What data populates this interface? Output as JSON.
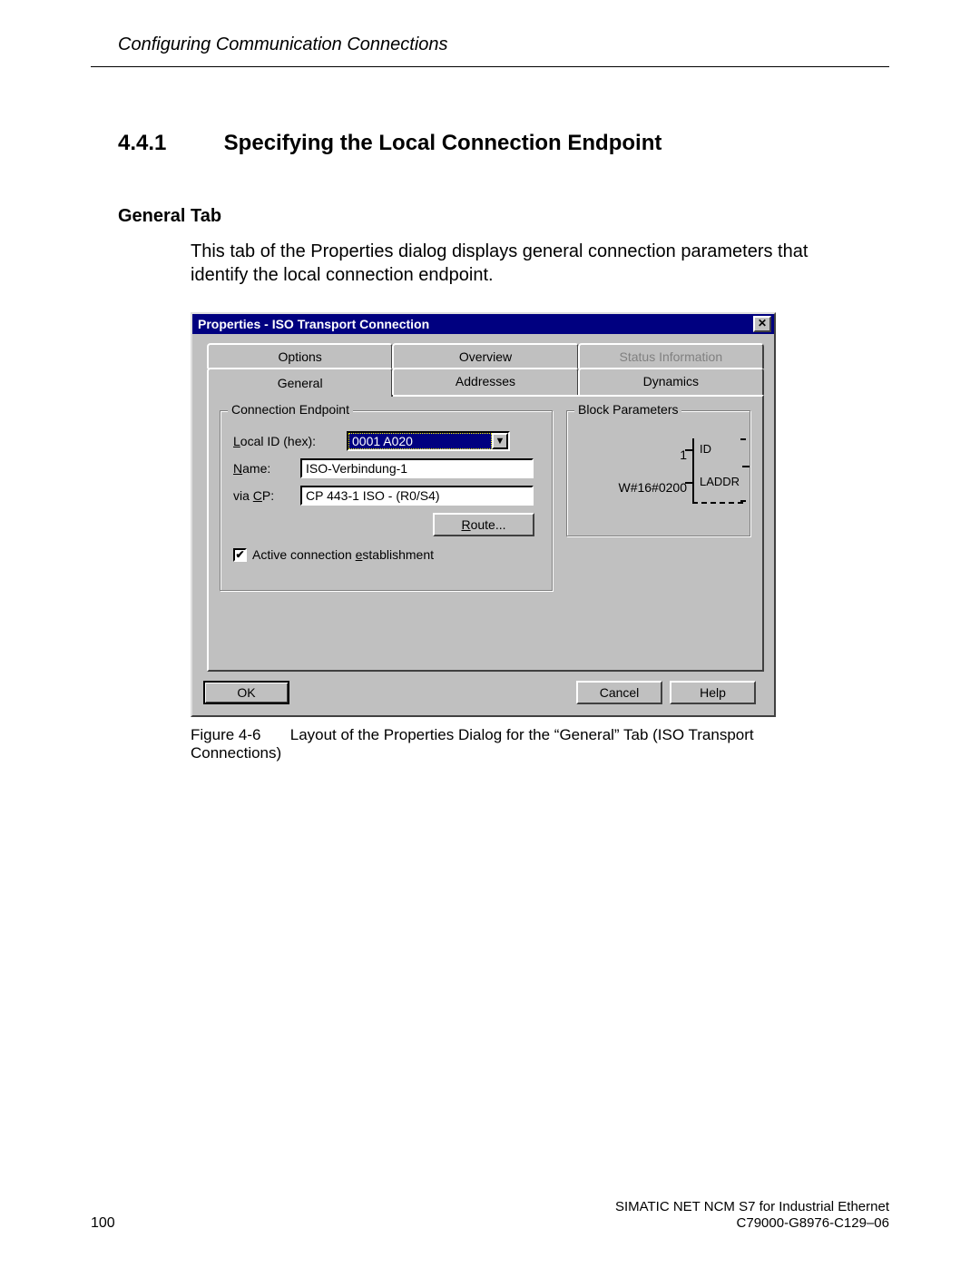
{
  "doc": {
    "running_head": "Configuring Communication Connections",
    "section_no": "4.4.1",
    "section_title": "Specifying the Local Connection Endpoint",
    "subheading": "General Tab",
    "body": "This tab of the Properties dialog displays general connection parameters that identify the local connection endpoint.",
    "figure_no": "Figure 4-6",
    "figure_caption": "Layout of the Properties Dialog for the “General” Tab (ISO Transport Connections)",
    "page_number": "100",
    "footer1": "SIMATIC NET NCM S7 for Industrial Ethernet",
    "footer2": "C79000-G8976-C129–06"
  },
  "dialog": {
    "title": "Properties - ISO Transport Connection",
    "tabs_back": [
      {
        "label": "Options",
        "disabled": false
      },
      {
        "label": "Overview",
        "disabled": false
      },
      {
        "label": "Status Information",
        "disabled": true
      }
    ],
    "tabs_front": [
      {
        "label": "General",
        "active": true
      },
      {
        "label": "Addresses"
      },
      {
        "label": "Dynamics"
      }
    ],
    "conn_group": {
      "legend": "Connection Endpoint",
      "local_id_label_pre": "L",
      "local_id_label_post": "ocal ID (hex):",
      "local_id_value": "0001 A020",
      "name_label_pre": "N",
      "name_label_post": "ame:",
      "name_value": "ISO-Verbindung-1",
      "viacp_label_pre": "via ",
      "viacp_label_u": "C",
      "viacp_label_post": "P:",
      "viacp_value": "CP 443-1 ISO - (R0/S4)",
      "route_label": "Route...",
      "route_accel": "R",
      "checkbox_label_pre": "Active connection ",
      "checkbox_label_u": "e",
      "checkbox_label_post": "stablishment",
      "checkbox_checked": true
    },
    "block_group": {
      "legend": "Block Parameters",
      "id_value": "1",
      "id_label": "ID",
      "laddr_value": "W#16#0200",
      "laddr_label": "LADDR"
    },
    "buttons": {
      "ok": "OK",
      "cancel": "Cancel",
      "help": "Help"
    }
  }
}
